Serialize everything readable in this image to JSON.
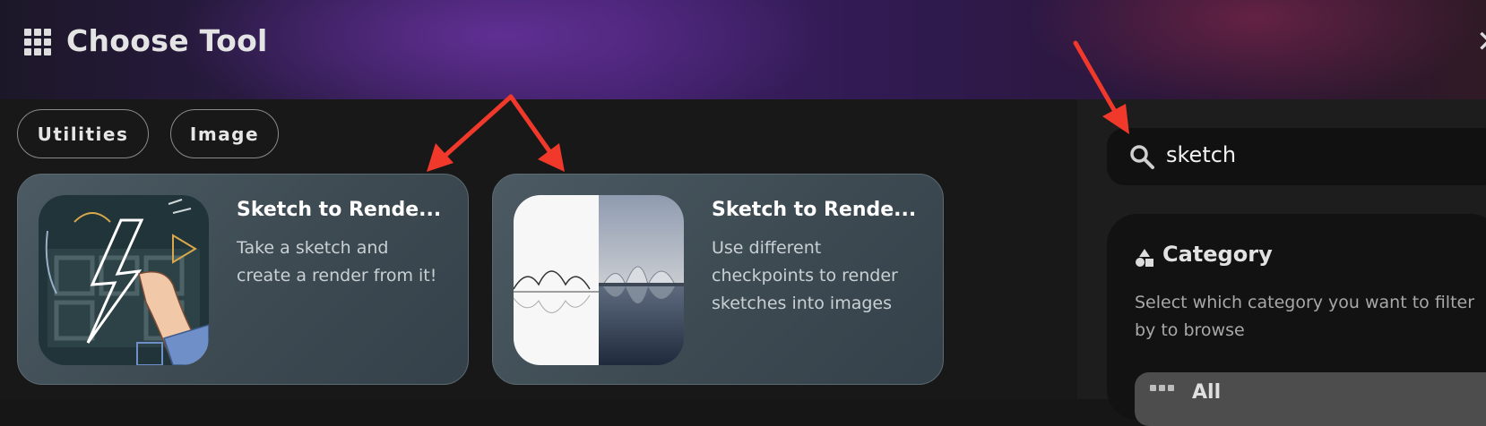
{
  "header": {
    "title": "Choose Tool",
    "grid_icon": "grid-icon",
    "close_icon": "close-icon",
    "close_glyph": "✕"
  },
  "filters": [
    {
      "label": "Utilities"
    },
    {
      "label": "Image"
    }
  ],
  "cards": [
    {
      "title": "Sketch to Rende...",
      "description": "Take a sketch and create a render from it!",
      "thumbnail": "chalk-lightning-hand-image"
    },
    {
      "title": "Sketch to Rende...",
      "description": "Use different checkpoints to render sketches into images",
      "thumbnail": "sketch-vs-render-building-image"
    }
  ],
  "search": {
    "value": "sketch",
    "icon": "search-icon"
  },
  "category": {
    "title": "Category",
    "description": "Select which category you want to filter by to browse",
    "icon": "shapes-icon",
    "all_button": {
      "label": "All",
      "icon": "grid-icon"
    }
  },
  "annotations": {
    "arrow_color": "#f0392b",
    "arrows": "annotation-arrows"
  },
  "colors": {
    "header_purple": "#3d1f66",
    "card_bg": "#4b5a63",
    "page_bg": "#181818"
  }
}
